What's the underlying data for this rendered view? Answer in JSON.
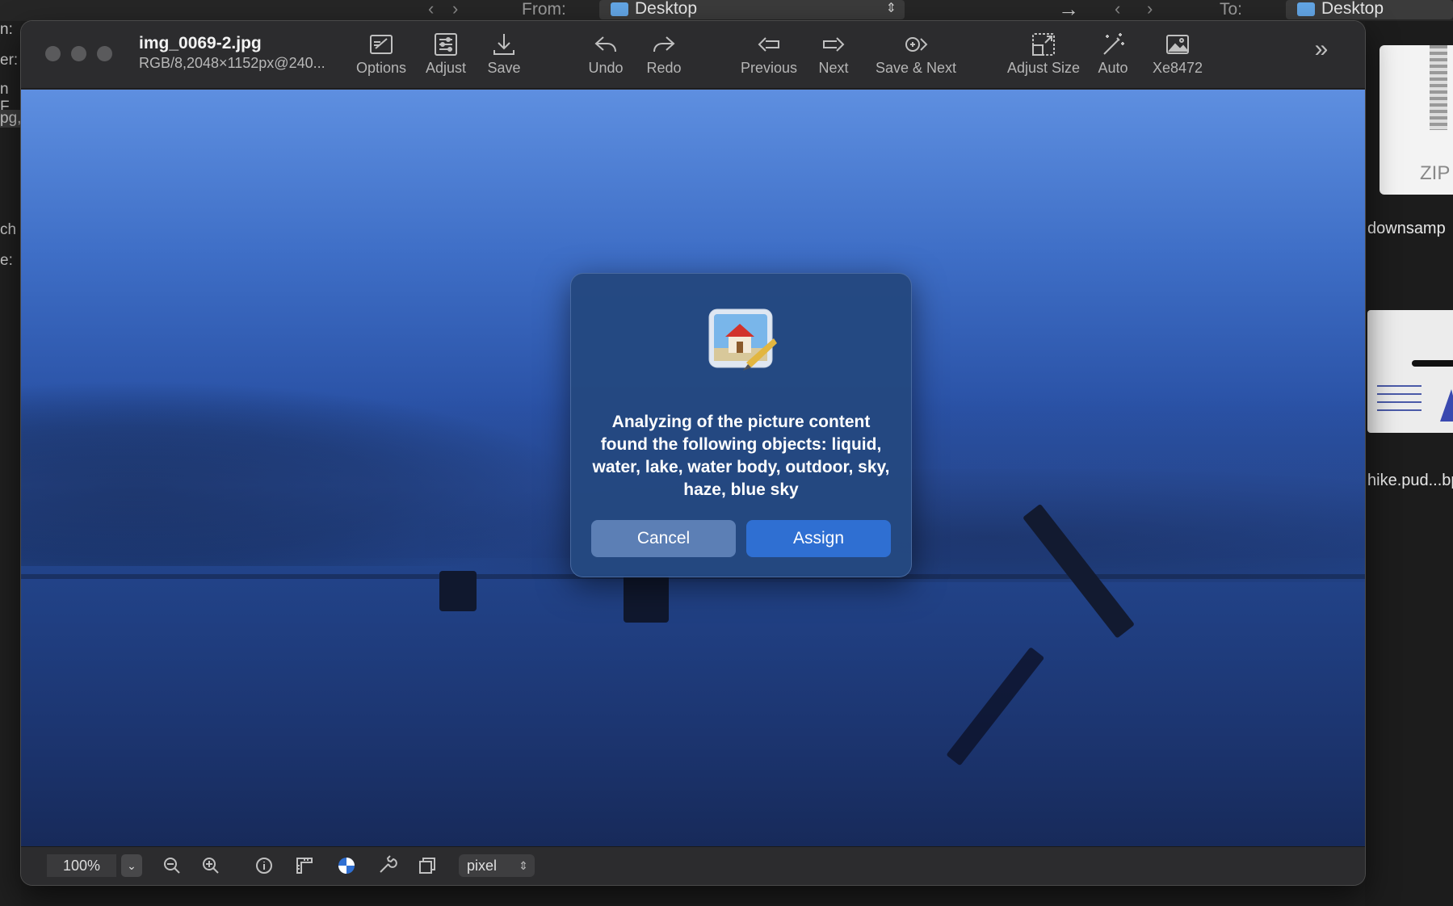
{
  "background": {
    "from_label": "From:",
    "to_label": "To:",
    "from_folder": "Desktop",
    "to_folder": "Desktop",
    "left_fragments": [
      "n:",
      "er:",
      "n F",
      "pg,",
      "ch",
      "e:"
    ],
    "right_items": [
      {
        "label": "downsamp",
        "badge": "ZIP"
      },
      {
        "label": "hike.pud...bp"
      }
    ]
  },
  "window": {
    "title": "img_0069-2.jpg",
    "subtitle": "RGB/8,2048×1152px@240..."
  },
  "toolbar": {
    "options": "Options",
    "adjust": "Adjust",
    "save": "Save",
    "undo": "Undo",
    "redo": "Redo",
    "previous": "Previous",
    "next": "Next",
    "save_next": "Save & Next",
    "adjust_size": "Adjust Size",
    "auto": "Auto",
    "xe": "Xe8472"
  },
  "dialog": {
    "message": "Analyzing of the picture content found the following objects: liquid, water, lake, water body, outdoor, sky, haze, blue sky",
    "cancel": "Cancel",
    "assign": "Assign"
  },
  "statusbar": {
    "zoom": "100%",
    "unit": "pixel"
  }
}
